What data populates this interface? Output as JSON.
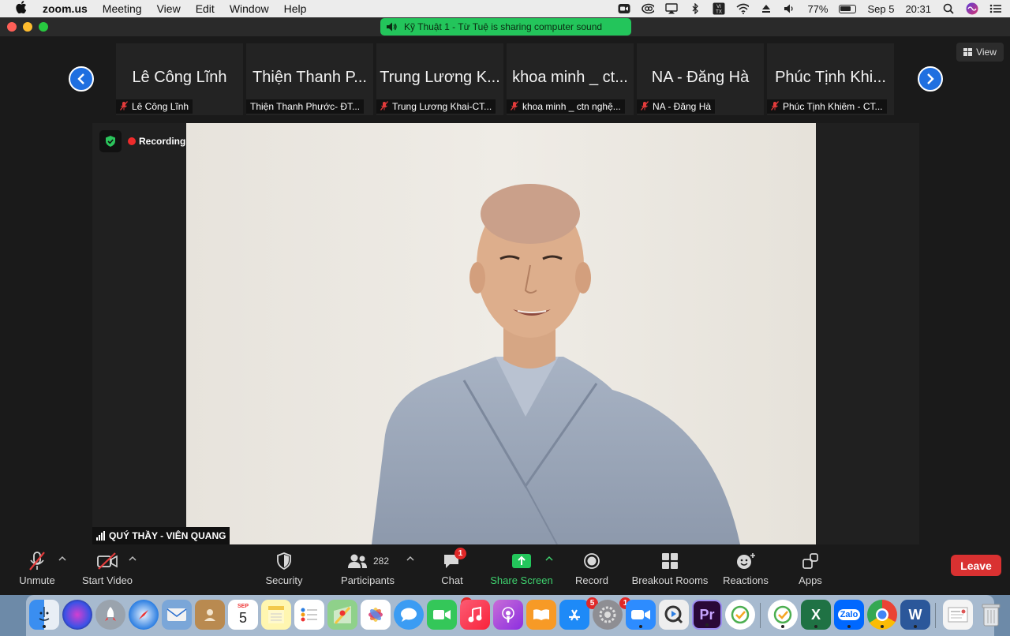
{
  "menubar": {
    "app_name": "zoom.us",
    "menus": [
      "Meeting",
      "View",
      "Edit",
      "Window",
      "Help"
    ],
    "battery": "77%",
    "date": "Sep 5",
    "time": "20:31",
    "keyboard_layout": "VI TX"
  },
  "share_banner": {
    "text": "Kỹ Thuật 1  - Từ Tuệ is sharing computer sound"
  },
  "view_button": {
    "label": "View"
  },
  "thumbnails": [
    {
      "big": "Lê Công Lĩnh",
      "small": "Lê Công Lĩnh",
      "muted": true
    },
    {
      "big": "Thiện Thanh P...",
      "small": "Thiện Thanh Phước- ĐT...",
      "muted": false
    },
    {
      "big": "Trung Lương K...",
      "small": "Trung Lương Khai-CT...",
      "muted": true
    },
    {
      "big": "khoa minh _ ct...",
      "small": "khoa minh _ ctn nghệ...",
      "muted": true
    },
    {
      "big": "NA - Đăng Hà",
      "small": "NA - Đăng Hà",
      "muted": true
    },
    {
      "big": "Phúc Tịnh Khi...",
      "small": "Phúc Tịnh Khiêm - CT...",
      "muted": true
    }
  ],
  "recording": {
    "label": "Recording"
  },
  "speaker": {
    "name": "QUÝ THẦY - VIÊN QUANG"
  },
  "toolbar": {
    "unmute": "Unmute",
    "start_video": "Start Video",
    "security": "Security",
    "participants": "Participants",
    "participants_count": "282",
    "chat": "Chat",
    "chat_badge": "1",
    "share_screen": "Share Screen",
    "record": "Record",
    "breakout_rooms": "Breakout Rooms",
    "reactions": "Reactions",
    "apps": "Apps",
    "leave": "Leave"
  },
  "dock": {
    "calendar_month": "SEP",
    "calendar_day": "5",
    "facetime_badge": "1",
    "appstore_badge": "5",
    "settings_badge": "1"
  },
  "colors": {
    "share_green": "#23c55b",
    "leave_red": "#d93131",
    "nav_blue": "#1f6fe0",
    "record_red": "#ee2b2b"
  }
}
